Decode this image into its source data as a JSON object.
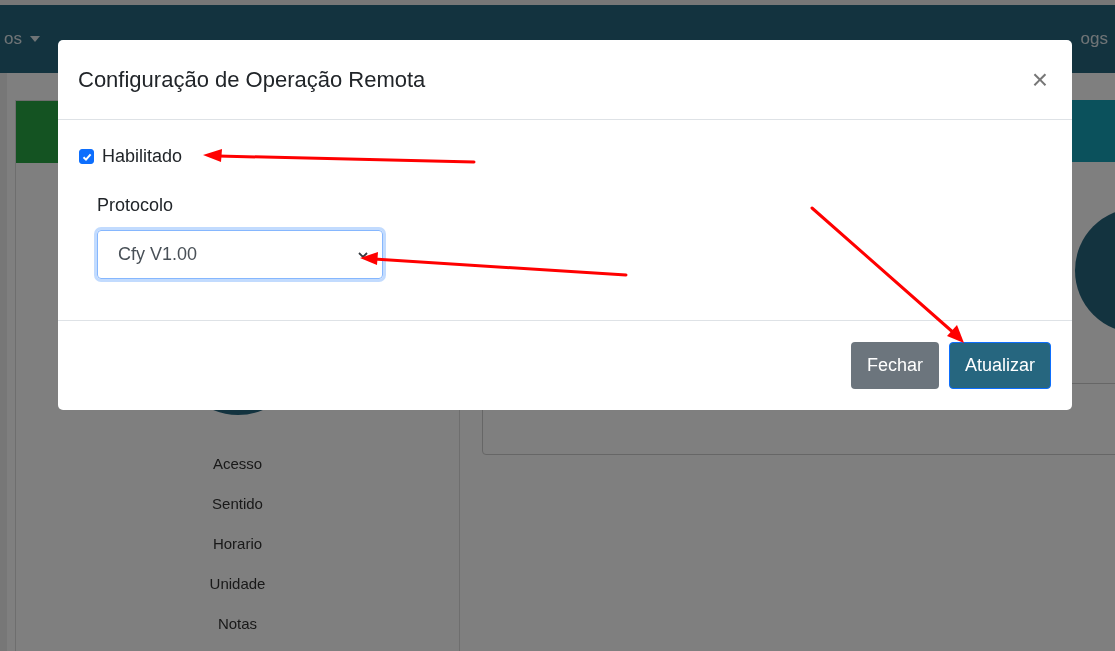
{
  "nav": {
    "items": [
      {
        "label": "os",
        "caret": true
      },
      {
        "label": "ogs",
        "caret": false
      }
    ]
  },
  "profile": {
    "items": [
      "Acesso",
      "Sentido",
      "Horario",
      "Unidade",
      "Notas"
    ]
  },
  "modal": {
    "title": "Configuração de Operação Remota",
    "close": "×",
    "enabled": {
      "label": "Habilitado",
      "checked": true
    },
    "protocol": {
      "label": "Protocolo",
      "value": "Cfy V1.00"
    },
    "buttons": [
      {
        "label": "Fechar",
        "kind": "secondary"
      },
      {
        "label": "Atualizar",
        "kind": "primary"
      }
    ]
  }
}
